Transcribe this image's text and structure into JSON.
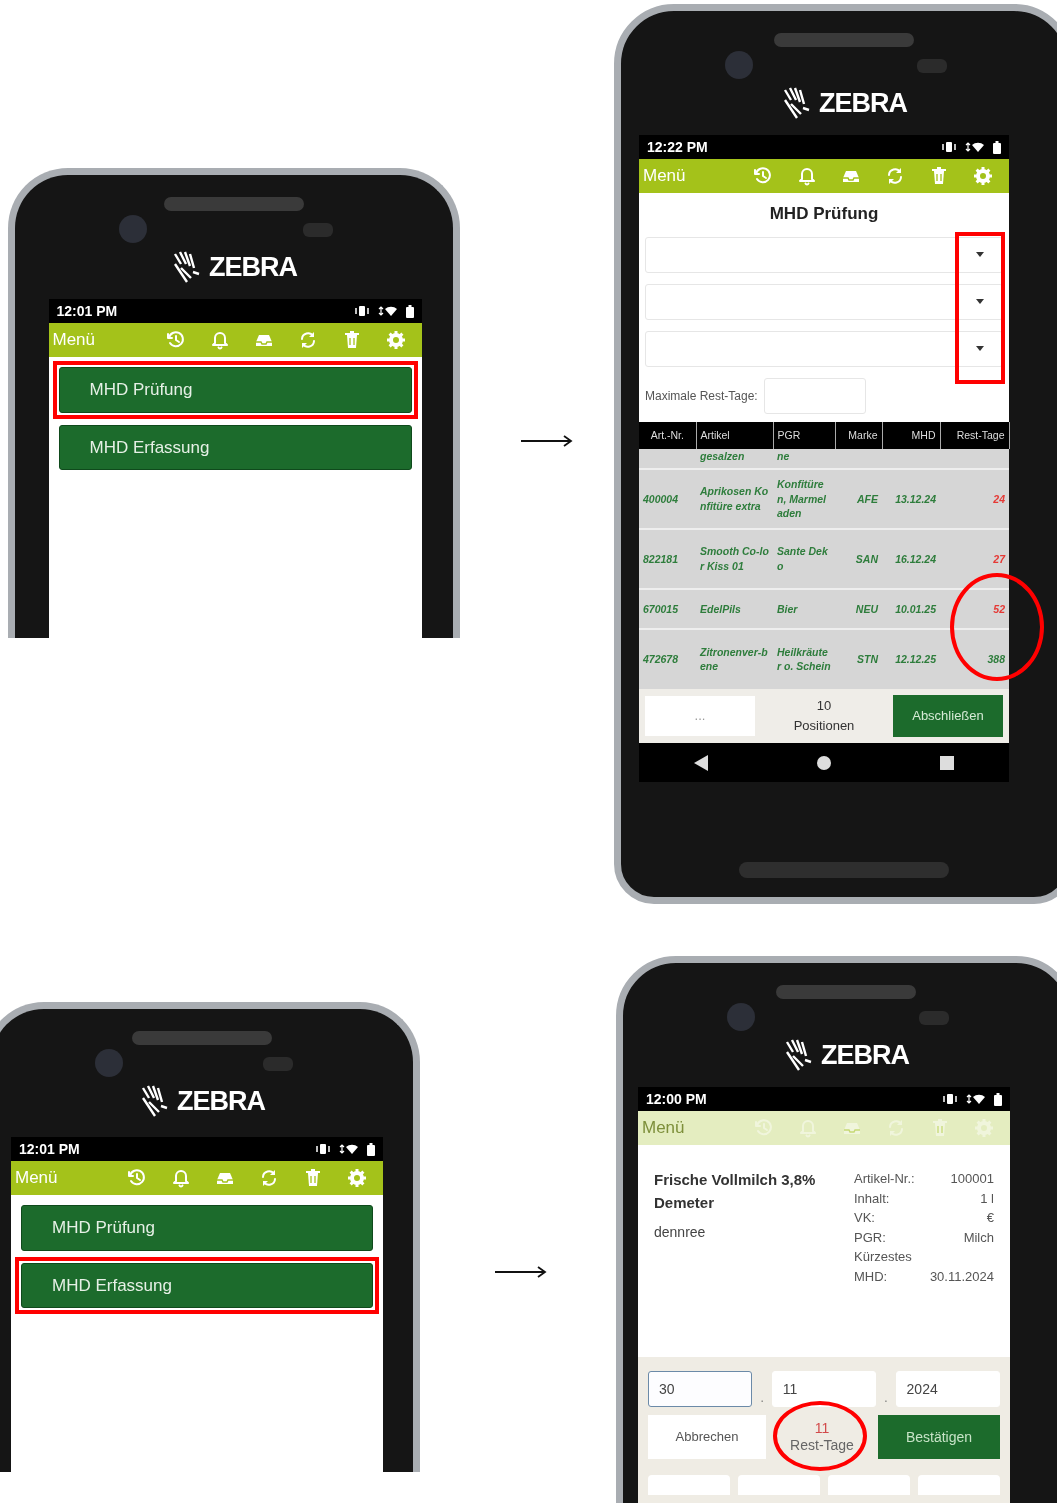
{
  "phones": [
    {
      "kind": "menu",
      "brand": "ZEBRA",
      "status_time": "12:01 PM",
      "toolbar": {
        "title": "Menü",
        "dimmed": false
      },
      "menu_items": [
        {
          "label": "MHD Prüfung",
          "highlighted": true
        },
        {
          "label": "MHD Erfassung",
          "highlighted": false
        }
      ]
    },
    {
      "kind": "list",
      "brand": "ZEBRA",
      "status_time": "12:22 PM",
      "toolbar": {
        "title": "Menü",
        "dimmed": false
      },
      "title": "MHD Prüfung",
      "dropdowns": [
        {
          "kind": "select"
        },
        {
          "kind": "select"
        },
        {
          "kind": "select"
        }
      ],
      "dropdowns_highlighted": true,
      "max_rest_label": "Maximale Rest-Tage:",
      "table": {
        "columns": [
          "Art.-Nr.",
          "Artikel",
          "PGR",
          "Marke",
          "MHD",
          "Rest-Tage"
        ],
        "rows": [
          {
            "artikel": "gesalzen",
            "pgr": "ne"
          },
          {
            "art_nr": "400004",
            "artikel": "Aprikosen Konfitüre extra",
            "pgr": "Konfitüren, Marmeladen",
            "marke": "AFE",
            "mhd": "13.12.24",
            "rest_tage": "24",
            "warning": true
          },
          {
            "art_nr": "822181",
            "artikel": "Smooth Co-lor Kiss 01",
            "pgr": "Sante Deko",
            "marke": "SAN",
            "mhd": "16.12.24",
            "rest_tage": "27",
            "warning": true
          },
          {
            "art_nr": "670015",
            "artikel": "EdelPils",
            "pgr": "Bier",
            "marke": "NEU",
            "mhd": "10.01.25",
            "rest_tage": "52",
            "warning": true
          },
          {
            "art_nr": "472678",
            "artikel": "Zitronenver-bene",
            "pgr": "Heilkräuter o. Schein",
            "marke": "STN",
            "mhd": "12.12.25",
            "rest_tage": "388",
            "warning": false
          }
        ]
      },
      "rest_days_highlighted": true,
      "footer": {
        "more": "...",
        "count": "10",
        "count_label": "Positionen",
        "finish": "Abschließen"
      }
    },
    {
      "kind": "menu",
      "brand": "ZEBRA",
      "status_time": "12:01 PM",
      "toolbar": {
        "title": "Menü",
        "dimmed": false
      },
      "menu_items": [
        {
          "label": "MHD Prüfung",
          "highlighted": false
        },
        {
          "label": "MHD Erfassung",
          "highlighted": true
        }
      ]
    },
    {
      "kind": "detail",
      "brand": "ZEBRA",
      "status_time": "12:00 PM",
      "toolbar": {
        "title": "Menü",
        "dimmed": true
      },
      "product_name": "Frische Vollmilch 3,8% Demeter",
      "product_brand": "dennree",
      "info": [
        {
          "label": "Artikel-Nr.:",
          "value": "100001"
        },
        {
          "label": "Inhalt:",
          "value": "1 l"
        },
        {
          "label": "VK:",
          "value": "€"
        },
        {
          "label": "PGR:",
          "value": "Milch"
        },
        {
          "label": "Kürzestes MHD:",
          "value": "30.11.2024"
        }
      ],
      "date_fields": [
        {
          "value": "30",
          "focused": true,
          "separator": "."
        },
        {
          "value": "11",
          "focused": false,
          "separator": "."
        },
        {
          "value": "2024",
          "focused": false
        }
      ],
      "cancel": "Abbrechen",
      "rest_days": "11",
      "rest_days_label": "Rest-Tage",
      "rest_days_highlighted": true,
      "confirm": "Bestätigen"
    }
  ]
}
